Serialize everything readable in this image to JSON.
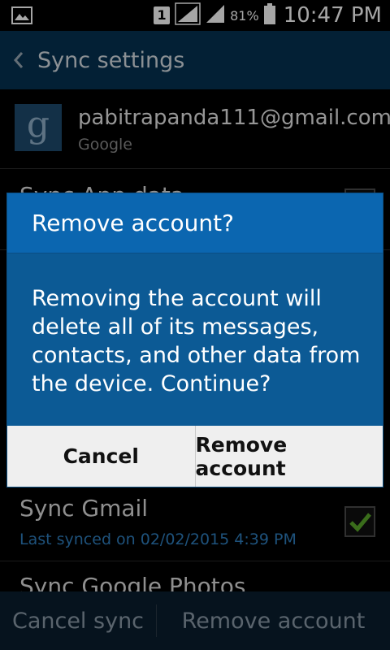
{
  "status_bar": {
    "sim_slot": "1",
    "battery_percent": "81%",
    "time": "10:47 PM"
  },
  "action_bar": {
    "title": "Sync settings"
  },
  "account": {
    "email": "pabitrapanda111@gmail.com",
    "type": "Google",
    "logo_letter": "g"
  },
  "sync_items": [
    {
      "title": "Sync App data"
    },
    {
      "title": "Sync Gmail",
      "subtitle": "Last synced on 02/02/2015 4:39 PM",
      "checked": true
    },
    {
      "title": "Sync Google Photos"
    }
  ],
  "bottom_bar": {
    "cancel_sync": "Cancel sync",
    "remove_account": "Remove account"
  },
  "dialog": {
    "title": "Remove account?",
    "message": "Removing the account will delete all of its messages, contacts, and other data from the device. Continue?",
    "cancel_label": "Cancel",
    "confirm_label": "Remove account"
  },
  "colors": {
    "action_bar": "#063252",
    "dialog_header": "#0b66b0",
    "dialog_body": "#0c5a95",
    "check_green": "#5aa82a",
    "link_blue": "#2f7fbf"
  }
}
